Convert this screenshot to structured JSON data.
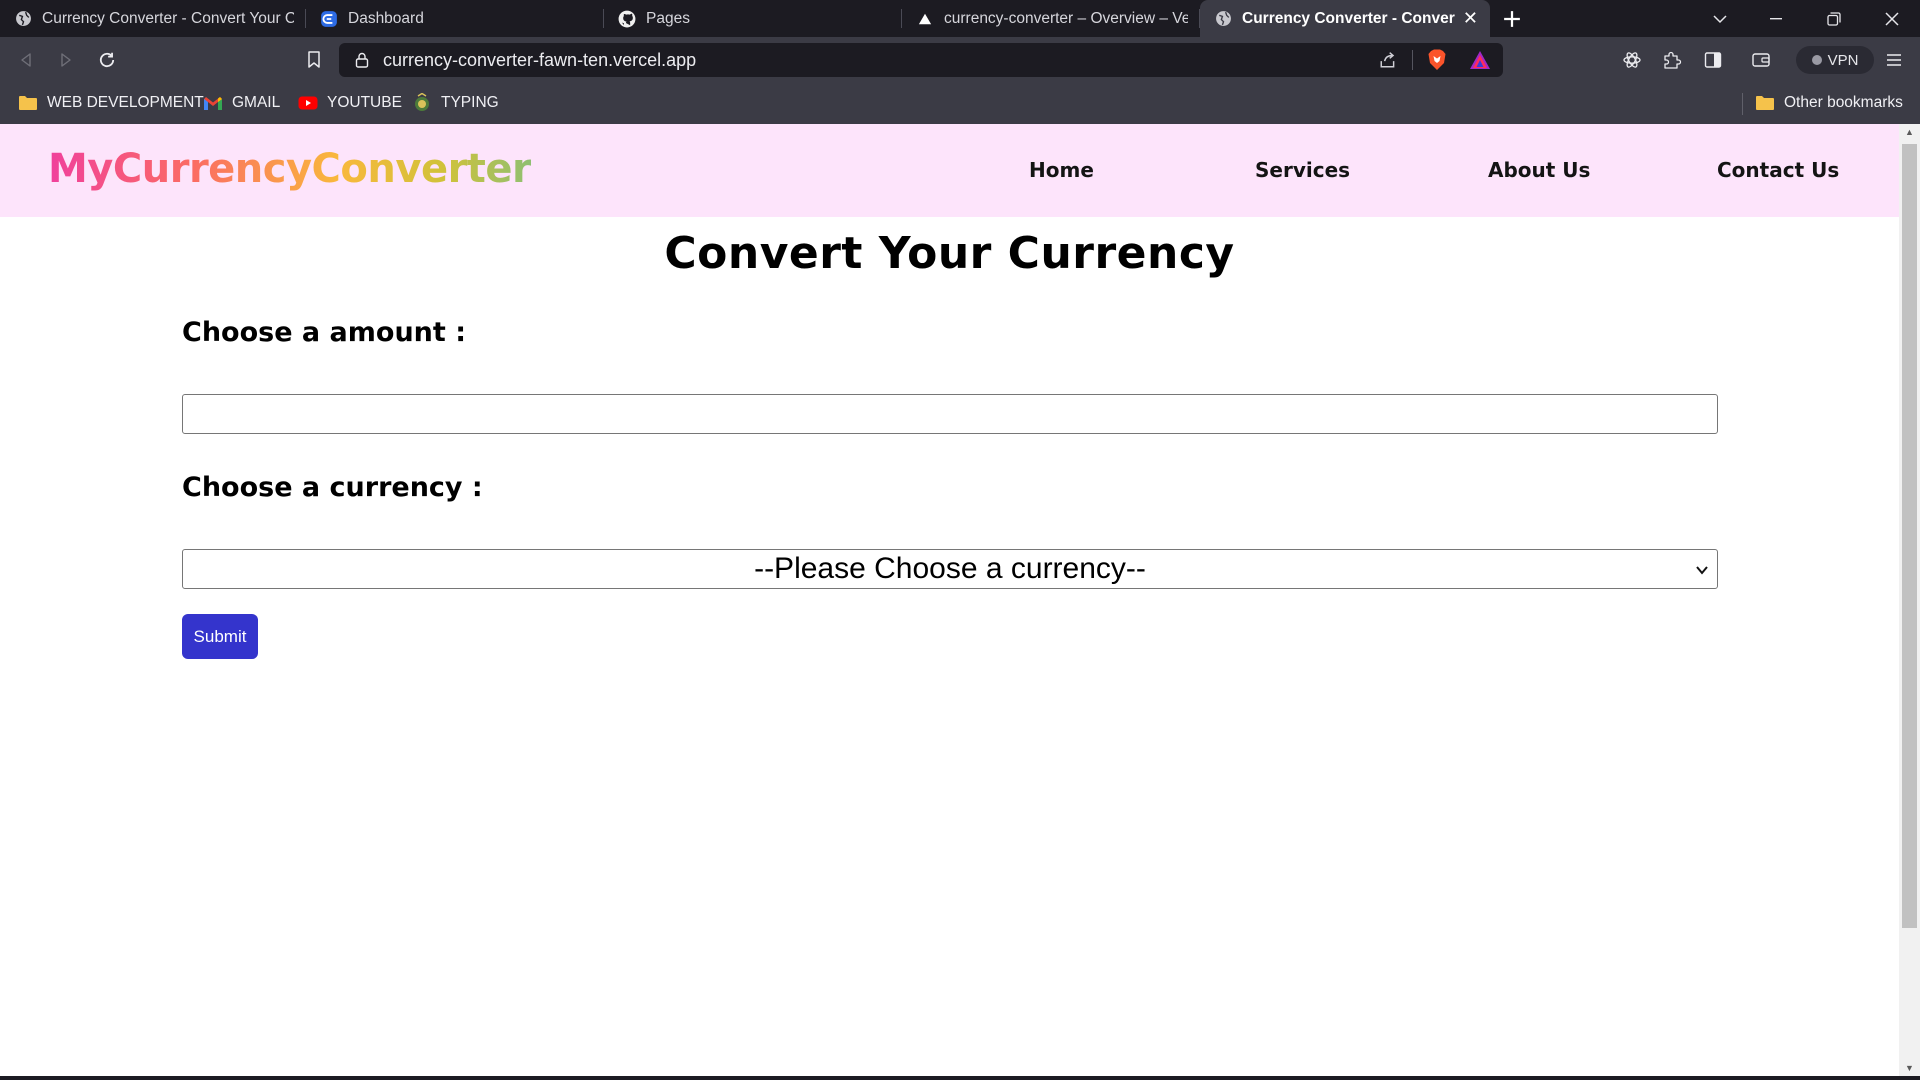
{
  "browser": {
    "tabs": [
      {
        "title": "Currency Converter - Convert Your Currency",
        "favicon": "globe-icon"
      },
      {
        "title": "Dashboard",
        "favicon": "app-logo-icon"
      },
      {
        "title": "Pages",
        "favicon": "github-icon"
      },
      {
        "title": "currency-converter – Overview – Vercel",
        "favicon": "vercel-icon"
      },
      {
        "title": "Currency Converter - Convert Your Currency",
        "favicon": "globe-icon",
        "active": true
      }
    ],
    "url": "currency-converter-fawn-ten.vercel.app",
    "vpn_label": "VPN",
    "bookmarks": [
      {
        "label": "WEB DEVELOPMENT",
        "icon": "folder-icon"
      },
      {
        "label": "GMAIL",
        "icon": "gmail-icon"
      },
      {
        "label": "YOUTUBE",
        "icon": "youtube-icon"
      },
      {
        "label": "TYPING",
        "icon": "typing-icon"
      }
    ],
    "other_bookmarks": "Other bookmarks"
  },
  "page": {
    "logo": "MyCurrencyConverter",
    "nav": [
      "Home",
      "Services",
      "About Us",
      "Contact Us"
    ],
    "title": "Convert Your Currency",
    "amount_label": "Choose a amount :",
    "amount_value": "",
    "currency_label": "Choose a currency :",
    "currency_selected": "--Please Choose a currency--",
    "submit_label": "Submit"
  },
  "colors": {
    "navbar_bg": "#fde4fb",
    "submit_bg": "#3434cc",
    "logo_gradient": [
      "#f0409c",
      "#fb6c63",
      "#f9b83c",
      "#d0c23a",
      "#8fbf72"
    ]
  }
}
